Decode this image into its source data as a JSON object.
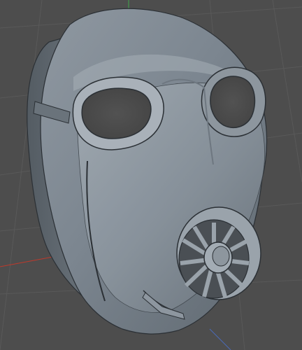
{
  "viewport": {
    "background": "#4d4d4d",
    "grid_color": "#595959",
    "axis_colors": {
      "x": "#c0392b",
      "y": "#3ea84a"
    }
  },
  "model": {
    "shading_light": "#9aa3ab",
    "shading_mid": "#7d8790",
    "shading_dark": "#3e454b",
    "edge": "#2b3035"
  }
}
